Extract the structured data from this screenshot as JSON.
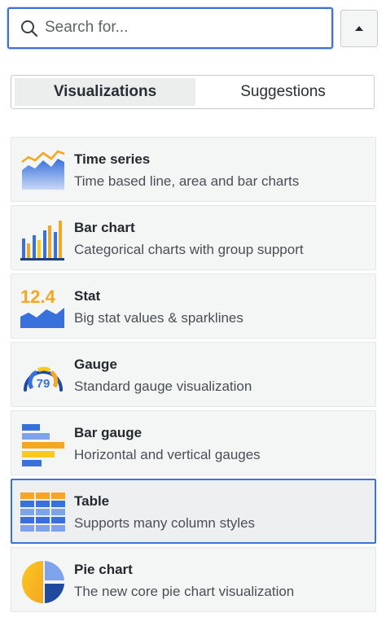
{
  "search": {
    "placeholder": "Search for...",
    "value": ""
  },
  "tabs": [
    {
      "label": "Visualizations",
      "active": true
    },
    {
      "label": "Suggestions",
      "active": false
    }
  ],
  "visualizations": [
    {
      "title": "Time series",
      "description": "Time based line, area and bar charts",
      "icon": "time-series-icon",
      "selected": false
    },
    {
      "title": "Bar chart",
      "description": "Categorical charts with group support",
      "icon": "bar-chart-icon",
      "selected": false
    },
    {
      "title": "Stat",
      "description": "Big stat values & sparklines",
      "icon": "stat-icon",
      "icon_text": "12.4",
      "selected": false
    },
    {
      "title": "Gauge",
      "description": "Standard gauge visualization",
      "icon": "gauge-icon",
      "icon_text": "79",
      "selected": false
    },
    {
      "title": "Bar gauge",
      "description": "Horizontal and vertical gauges",
      "icon": "bar-gauge-icon",
      "selected": false
    },
    {
      "title": "Table",
      "description": "Supports many column styles",
      "icon": "table-icon",
      "selected": true
    },
    {
      "title": "Pie chart",
      "description": "The new core pie chart visualization",
      "icon": "pie-chart-icon",
      "selected": false
    }
  ],
  "colors": {
    "accent": "#3d71d9",
    "icon_blue": "#3871dc",
    "icon_orange": "#f5a623",
    "icon_yellow": "#fbc81f",
    "item_background": "#f4f5f5"
  }
}
